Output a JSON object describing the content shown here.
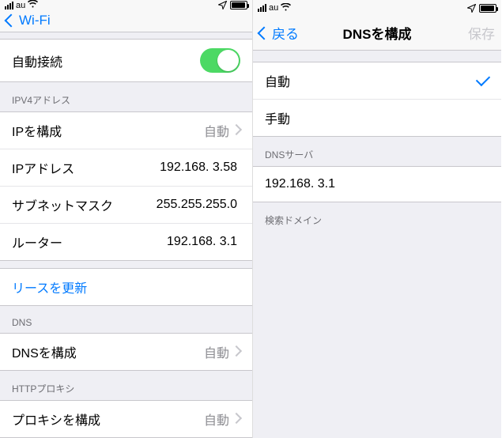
{
  "status": {
    "carrier": "au"
  },
  "left": {
    "nav_back": "Wi-Fi",
    "auto_join_label": "自動接続",
    "sections": {
      "ipv4_header": "IPV4アドレス",
      "configure_ip_label": "IPを構成",
      "configure_ip_value": "自動",
      "ip_address_label": "IPアドレス",
      "ip_address_value": "192.168.  3.58",
      "subnet_label": "サブネットマスク",
      "subnet_value": "255.255.255.0",
      "router_label": "ルーター",
      "router_value": "192.168.  3.1",
      "renew_lease": "リースを更新",
      "dns_header": "DNS",
      "configure_dns_label": "DNSを構成",
      "configure_dns_value": "自動",
      "http_proxy_header": "HTTPプロキシ",
      "configure_proxy_label": "プロキシを構成",
      "configure_proxy_value": "自動"
    }
  },
  "right": {
    "nav_back": "戻る",
    "nav_title": "DNSを構成",
    "nav_save": "保存",
    "options": {
      "auto": "自動",
      "manual": "手動"
    },
    "dns_servers_header": "DNSサーバ",
    "dns_server_value": "192.168.  3.1",
    "search_domains_header": "検索ドメイン"
  }
}
